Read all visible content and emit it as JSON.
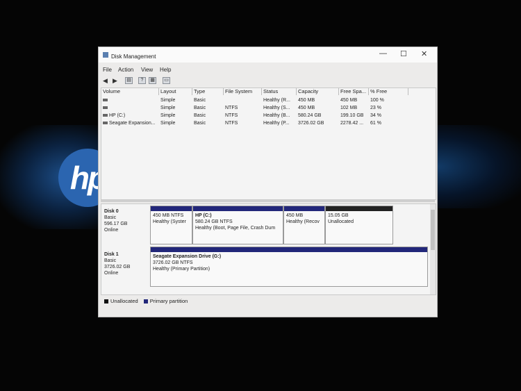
{
  "window": {
    "title": "Disk Management",
    "controls": {
      "minimize": "—",
      "maximize": "☐",
      "close": "✕"
    }
  },
  "menu": [
    "File",
    "Action",
    "View",
    "Help"
  ],
  "toolbar": [
    "back-icon",
    "forward-icon",
    "properties-icon",
    "help-icon",
    "console-icon",
    "list-icon"
  ],
  "volume_list": {
    "columns": [
      "Volume",
      "Layout",
      "Type",
      "File System",
      "Status",
      "Capacity",
      "Free Spa...",
      "% Free"
    ],
    "rows": [
      [
        "",
        "Simple",
        "Basic",
        "",
        "Healthy (R...",
        "450 MB",
        "450 MB",
        "100 %"
      ],
      [
        "",
        "Simple",
        "Basic",
        "NTFS",
        "Healthy (S...",
        "450 MB",
        "102 MB",
        "23 %"
      ],
      [
        "HP (C:)",
        "Simple",
        "Basic",
        "NTFS",
        "Healthy (B...",
        "580.24 GB",
        "199.10 GB",
        "34 %"
      ],
      [
        "Seagate Expansion...",
        "Simple",
        "Basic",
        "NTFS",
        "Healthy (P...",
        "3726.02 GB",
        "2278.42 ...",
        "61 %"
      ]
    ]
  },
  "disks": [
    {
      "name": "Disk 0",
      "type": "Basic",
      "size": "596.17 GB",
      "status": "Online",
      "partitions": [
        {
          "name": "",
          "size": "450 MB NTFS",
          "status": "Healthy (Syster"
        },
        {
          "name": "HP  (C:)",
          "size": "580.24 GB NTFS",
          "status": "Healthy (Boot, Page File, Crash Dum"
        },
        {
          "name": "",
          "size": "450 MB",
          "status": "Healthy (Recov"
        },
        {
          "name": "",
          "size": "15.05 GB",
          "status": "Unallocated"
        }
      ]
    },
    {
      "name": "Disk 1",
      "type": "Basic",
      "size": "3726.02 GB",
      "status": "Online",
      "partitions": [
        {
          "name": "Seagate Expansion Drive  (G:)",
          "size": "3726.02 GB NTFS",
          "status": "Healthy (Primary Partition)"
        }
      ]
    }
  ],
  "legend": [
    {
      "label": "Unallocated",
      "color": "#111111"
    },
    {
      "label": "Primary partition",
      "color": "#22277a"
    }
  ],
  "background_logo": "hp"
}
